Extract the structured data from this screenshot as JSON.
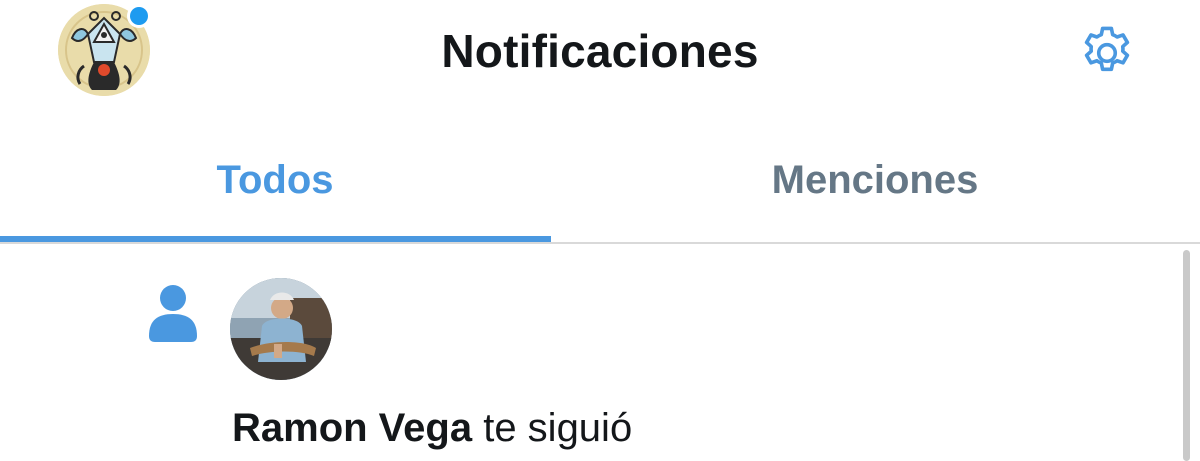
{
  "header": {
    "title": "Notificaciones",
    "profile_avatar": "profile-avatar",
    "unread_indicator": true,
    "settings_icon": "gear-icon"
  },
  "tabs": [
    {
      "label": "Todos",
      "active": true
    },
    {
      "label": "Menciones",
      "active": false
    }
  ],
  "notifications": [
    {
      "type_icon": "person-icon",
      "avatar": "follower-avatar",
      "user_name": "Ramon Vega",
      "action": "te siguió"
    }
  ],
  "colors": {
    "accent": "#4a98e0",
    "inactive_tab": "#657786",
    "text": "#14171a",
    "divider": "#d9d9d9",
    "unread_dot": "#1d9bf0"
  }
}
